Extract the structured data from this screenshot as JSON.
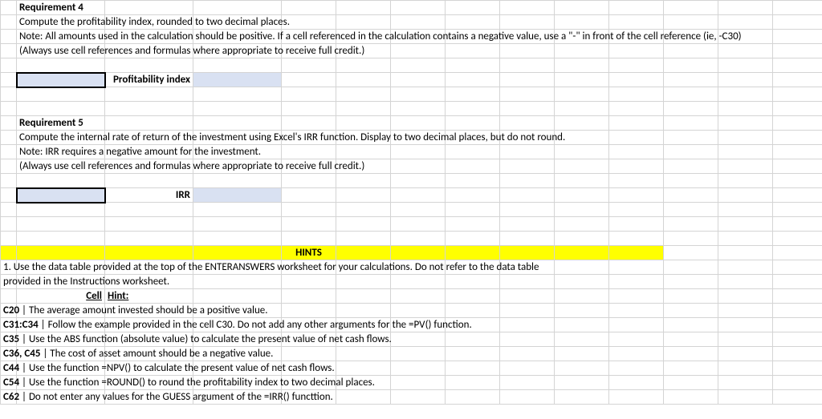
{
  "req4": {
    "title": "Requirement 4",
    "line1": "Compute the profitability index, rounded to two decimal places.",
    "line2": "Note: All amounts used in the calculation should be positive. If a cell referenced in the calculation contains a negative value, use a \"-\" in front of the cell reference (ie, -C30)",
    "line3": "(Always use cell references and formulas where appropriate to receive full credit.)",
    "label": "Profitability index"
  },
  "req5": {
    "title": "Requirement 5",
    "line1": "Compute the internal rate of return of the investment using Excel's IRR function. Display to two decimal places, but do not round.",
    "line2": "Note: IRR requires a negative amount for the investment.",
    "line3": "(Always use cell references and formulas where appropriate to receive full credit.)",
    "label": "IRR"
  },
  "hints": {
    "title": "HINTS",
    "intro": "1. Use the data table provided at the top of the ENTERANSWERS worksheet for your calculations. Do not refer to the data table provided in the Instructions worksheet.",
    "header_cell": "Cell",
    "header_hint": "Hint:",
    "rows": [
      {
        "cell": "C20",
        "text": " The average amount invested should be a positive value."
      },
      {
        "cell": "C31:C34",
        "text": " Follow the example provided in the cell C30. Do not add any other arguments for the =PV() function."
      },
      {
        "cell": "C35",
        "text": " Use the ABS function (absolute value) to calculate the present value of net cash flows."
      },
      {
        "cell": "C36, C45",
        "text": " The cost of asset amount should be a negative value."
      },
      {
        "cell": "C44",
        "text": " Use the function =NPV() to calculate the present value of net cash flows."
      },
      {
        "cell": "C54",
        "text": " Use the function =ROUND() to round the profitability index to two decimal places."
      },
      {
        "cell": "C62",
        "text": " Do not enter any values for the GUESS argument of the =IRR() functtion."
      }
    ]
  }
}
